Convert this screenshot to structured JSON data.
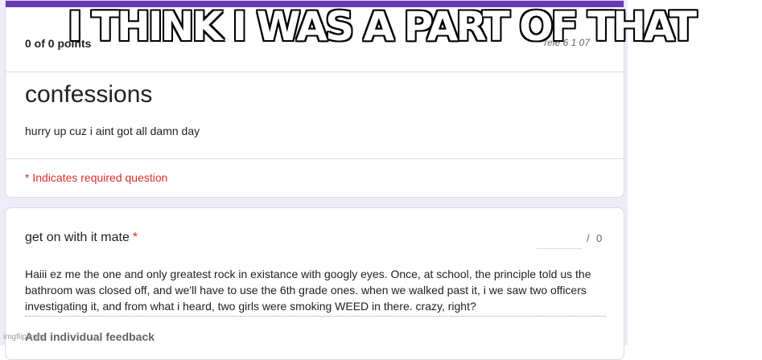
{
  "header_card": {
    "score": "0 of 0 points",
    "release_fragment": "rele            6 1 07",
    "title": "confessions",
    "description": "hurry up cuz i aint got all damn day",
    "required_notice": "* Indicates required question"
  },
  "question_card": {
    "title": "get on with it mate",
    "required_marker": "*",
    "points_slash": "/",
    "points_max": "0",
    "answer": "Haiii ez me the one and only greatest rock in existance with googly eyes. Once, at school, the principle told us the bathroom was closed off, and we'll have to use the 6th grade ones. when we walked past it, i we saw two officers investigating it, and from what i heard, two girls were smoking WEED in there. crazy, right?",
    "feedback_label": "Add individual feedback"
  },
  "meme": {
    "caption": "I THINK I WAS A PART OF THAT"
  },
  "watermark": "imgflip.com",
  "colors": {
    "accent": "#673ab7",
    "required": "#d93025",
    "page_bg": "#f0ebf8"
  }
}
